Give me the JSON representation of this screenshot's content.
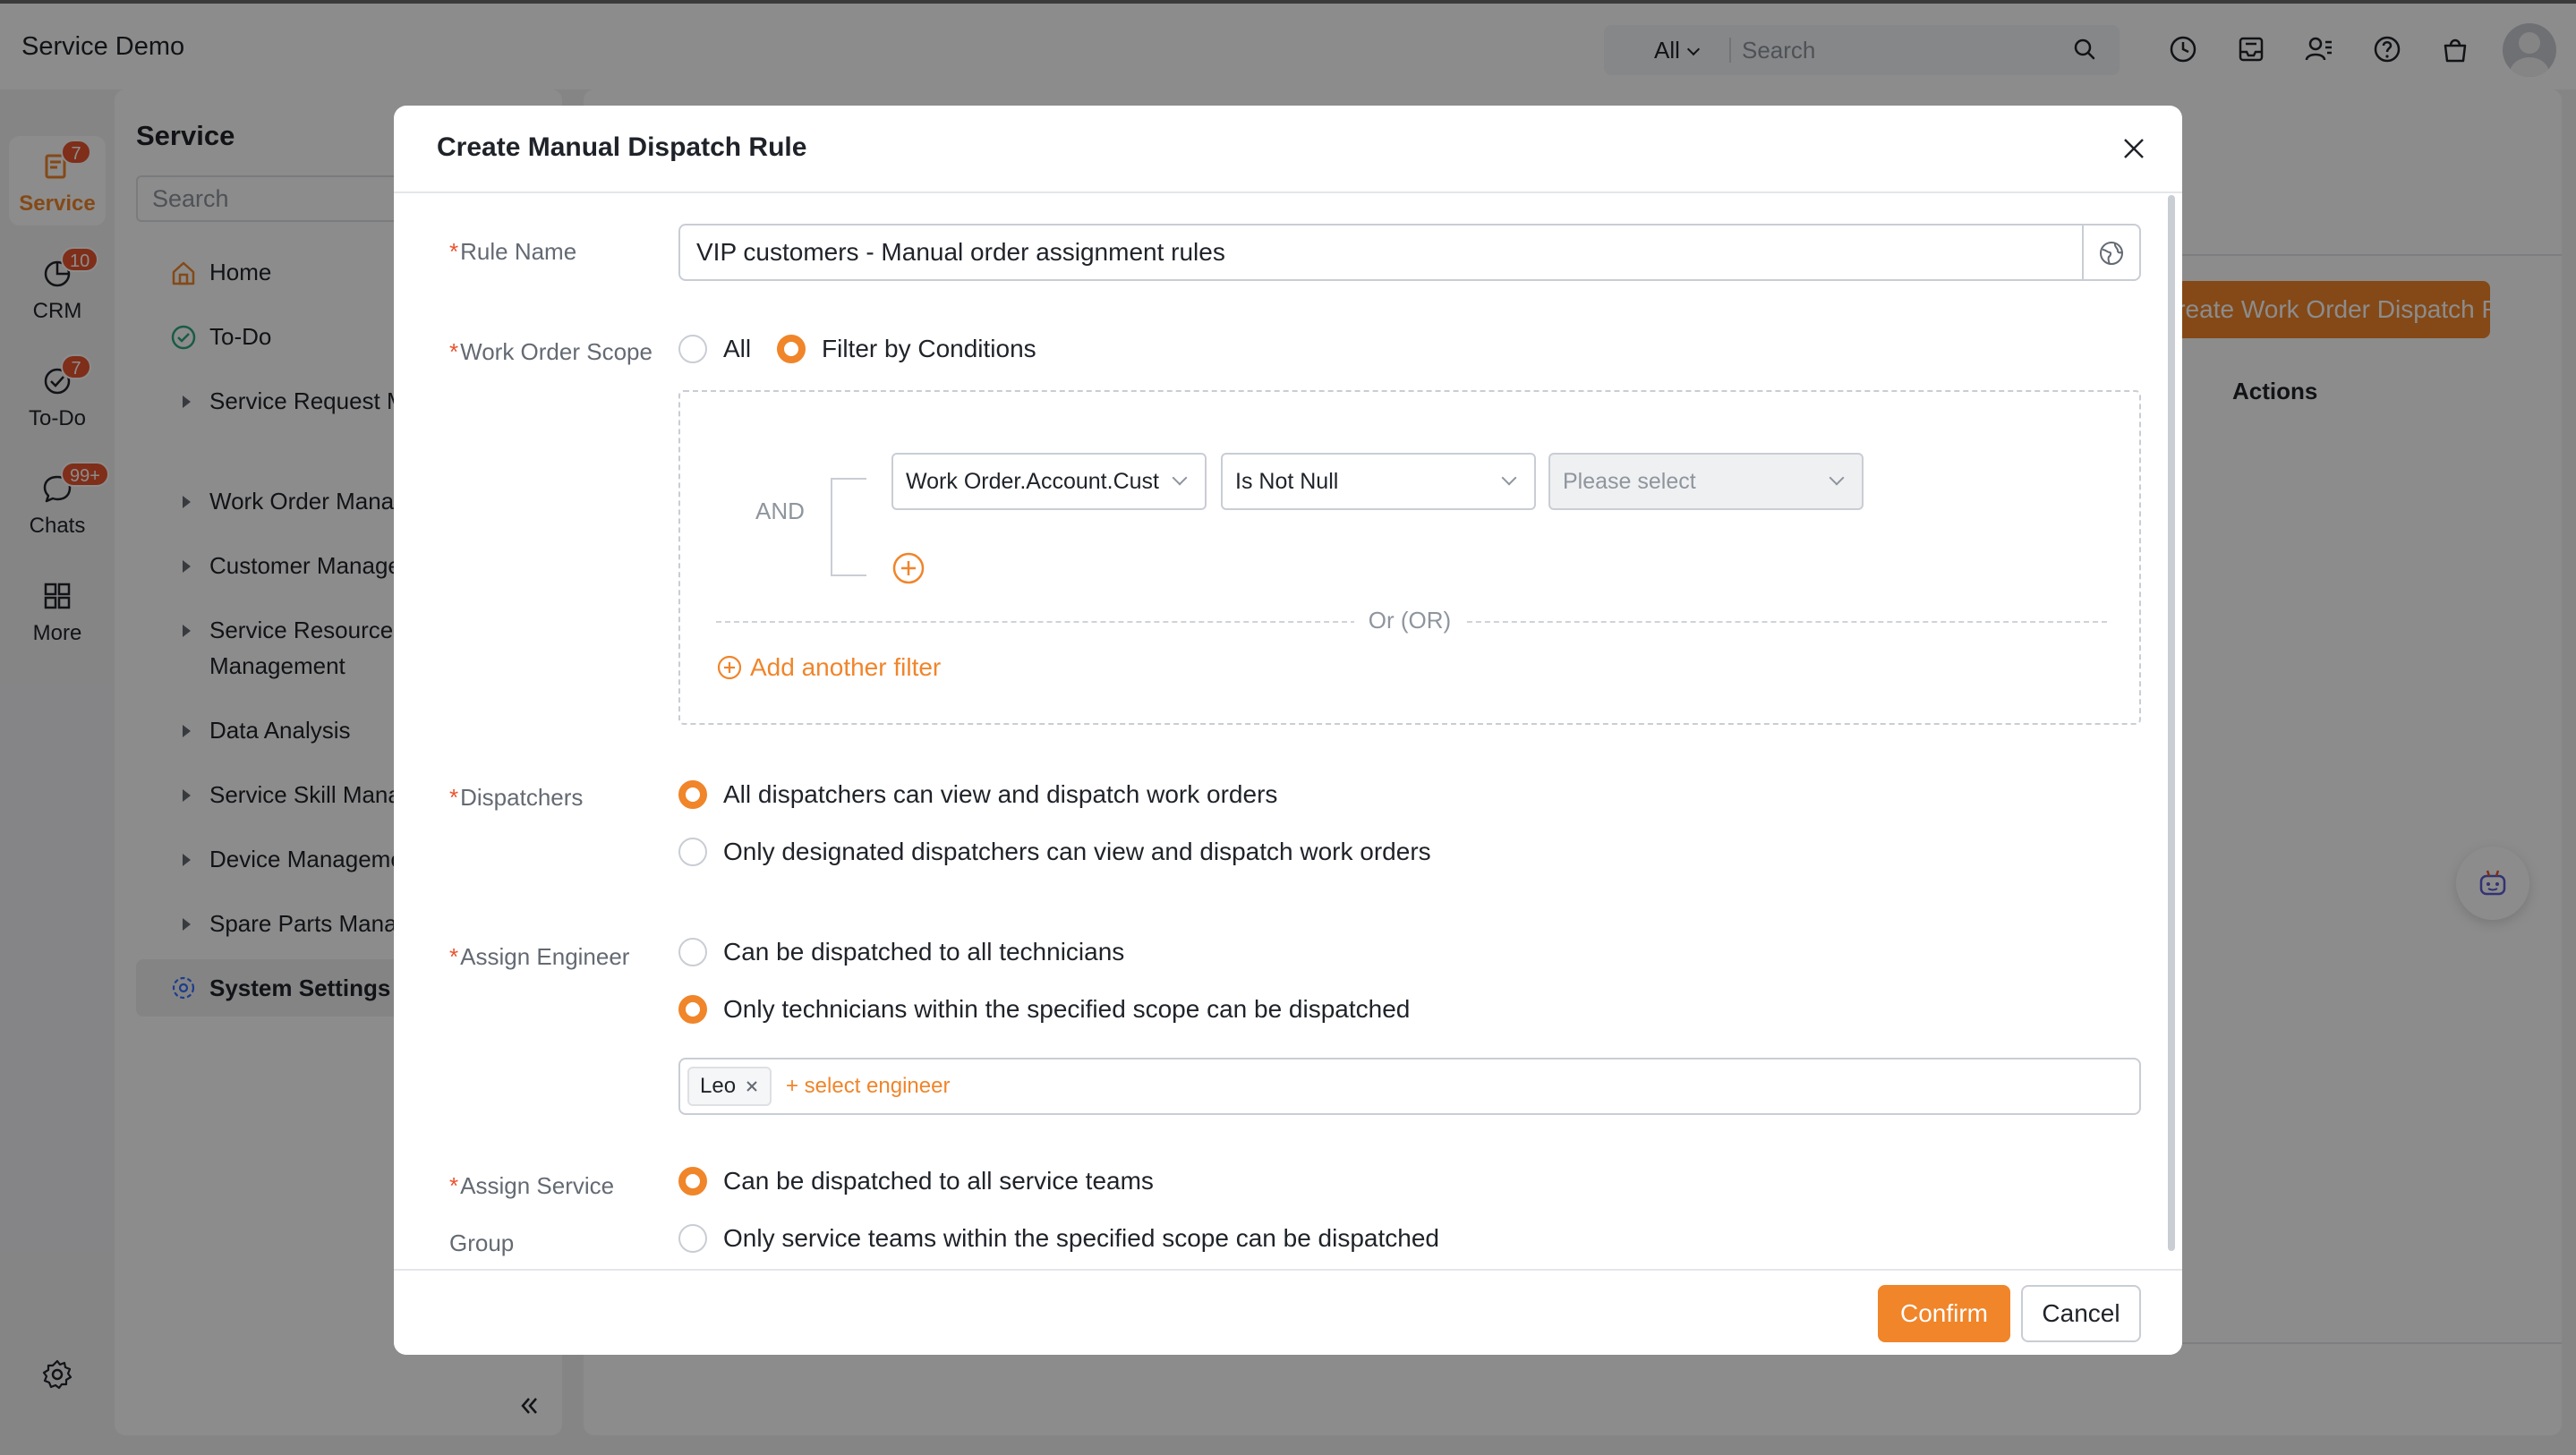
{
  "app": {
    "title": "Service Demo",
    "search_scope": "All",
    "search_placeholder": "Search"
  },
  "rail": {
    "items": [
      {
        "label": "Service",
        "badge": "7",
        "active": true,
        "icon": "service-icon"
      },
      {
        "label": "CRM",
        "badge": "10",
        "icon": "crm-icon"
      },
      {
        "label": "To-Do",
        "badge": "7",
        "icon": "todo-icon"
      },
      {
        "label": "Chats",
        "badge": "99+",
        "icon": "chat-icon"
      },
      {
        "label": "More",
        "badge": "",
        "icon": "grid-icon"
      }
    ]
  },
  "sidebar": {
    "title": "Service",
    "search_placeholder": "Search",
    "items": [
      {
        "label": "Home",
        "icon": "home-icon"
      },
      {
        "label": "To-Do",
        "icon": "check-circle-icon"
      },
      {
        "label": "Service Request Management"
      },
      {
        "label": "Work Order Management"
      },
      {
        "label": "Customer Management"
      },
      {
        "label": "Service Resource Management"
      },
      {
        "label": "Data Analysis"
      },
      {
        "label": "Service Skill Management"
      },
      {
        "label": "Device Management"
      },
      {
        "label": "Spare Parts Management"
      },
      {
        "label": "System Settings",
        "icon": "gear-icon"
      }
    ]
  },
  "main": {
    "create_button": "Create Work Order Dispatch Rule",
    "actions_header": "Actions"
  },
  "modal": {
    "title": "Create Manual Dispatch Rule",
    "rule_name": {
      "label": "Rule Name",
      "value": "VIP customers - Manual order assignment rules"
    },
    "scope": {
      "label": "Work Order Scope",
      "option_all": "All",
      "option_filter": "Filter by Conditions",
      "selected": "filter"
    },
    "filter": {
      "logic": "AND",
      "field": "Work Order.Account.Cust",
      "operator": "Is Not Null",
      "value_placeholder": "Please select",
      "or_label": "Or (OR)",
      "add_filter": "Add another filter"
    },
    "dispatchers": {
      "label": "Dispatchers",
      "option_all": "All dispatchers can view and dispatch work orders",
      "option_designated": "Only designated dispatchers can view and dispatch work orders",
      "selected": "all"
    },
    "engineer": {
      "label": "Assign Engineer",
      "option_all": "Can be dispatched to all technicians",
      "option_scope": "Only technicians within the specified scope can be dispatched",
      "selected": "scope",
      "tags": [
        "Leo"
      ],
      "select_link": "+ select engineer"
    },
    "service_group": {
      "label_line1": "Assign Service",
      "label_line2": "Group",
      "option_all": "Can be dispatched to all service teams",
      "option_scope": "Only service teams within the specified scope can be dispatched",
      "selected": "all"
    },
    "confirm": "Confirm",
    "cancel": "Cancel"
  },
  "colors": {
    "accent": "#f0852a",
    "required": "#e8542f",
    "badge": "#e8542f"
  }
}
